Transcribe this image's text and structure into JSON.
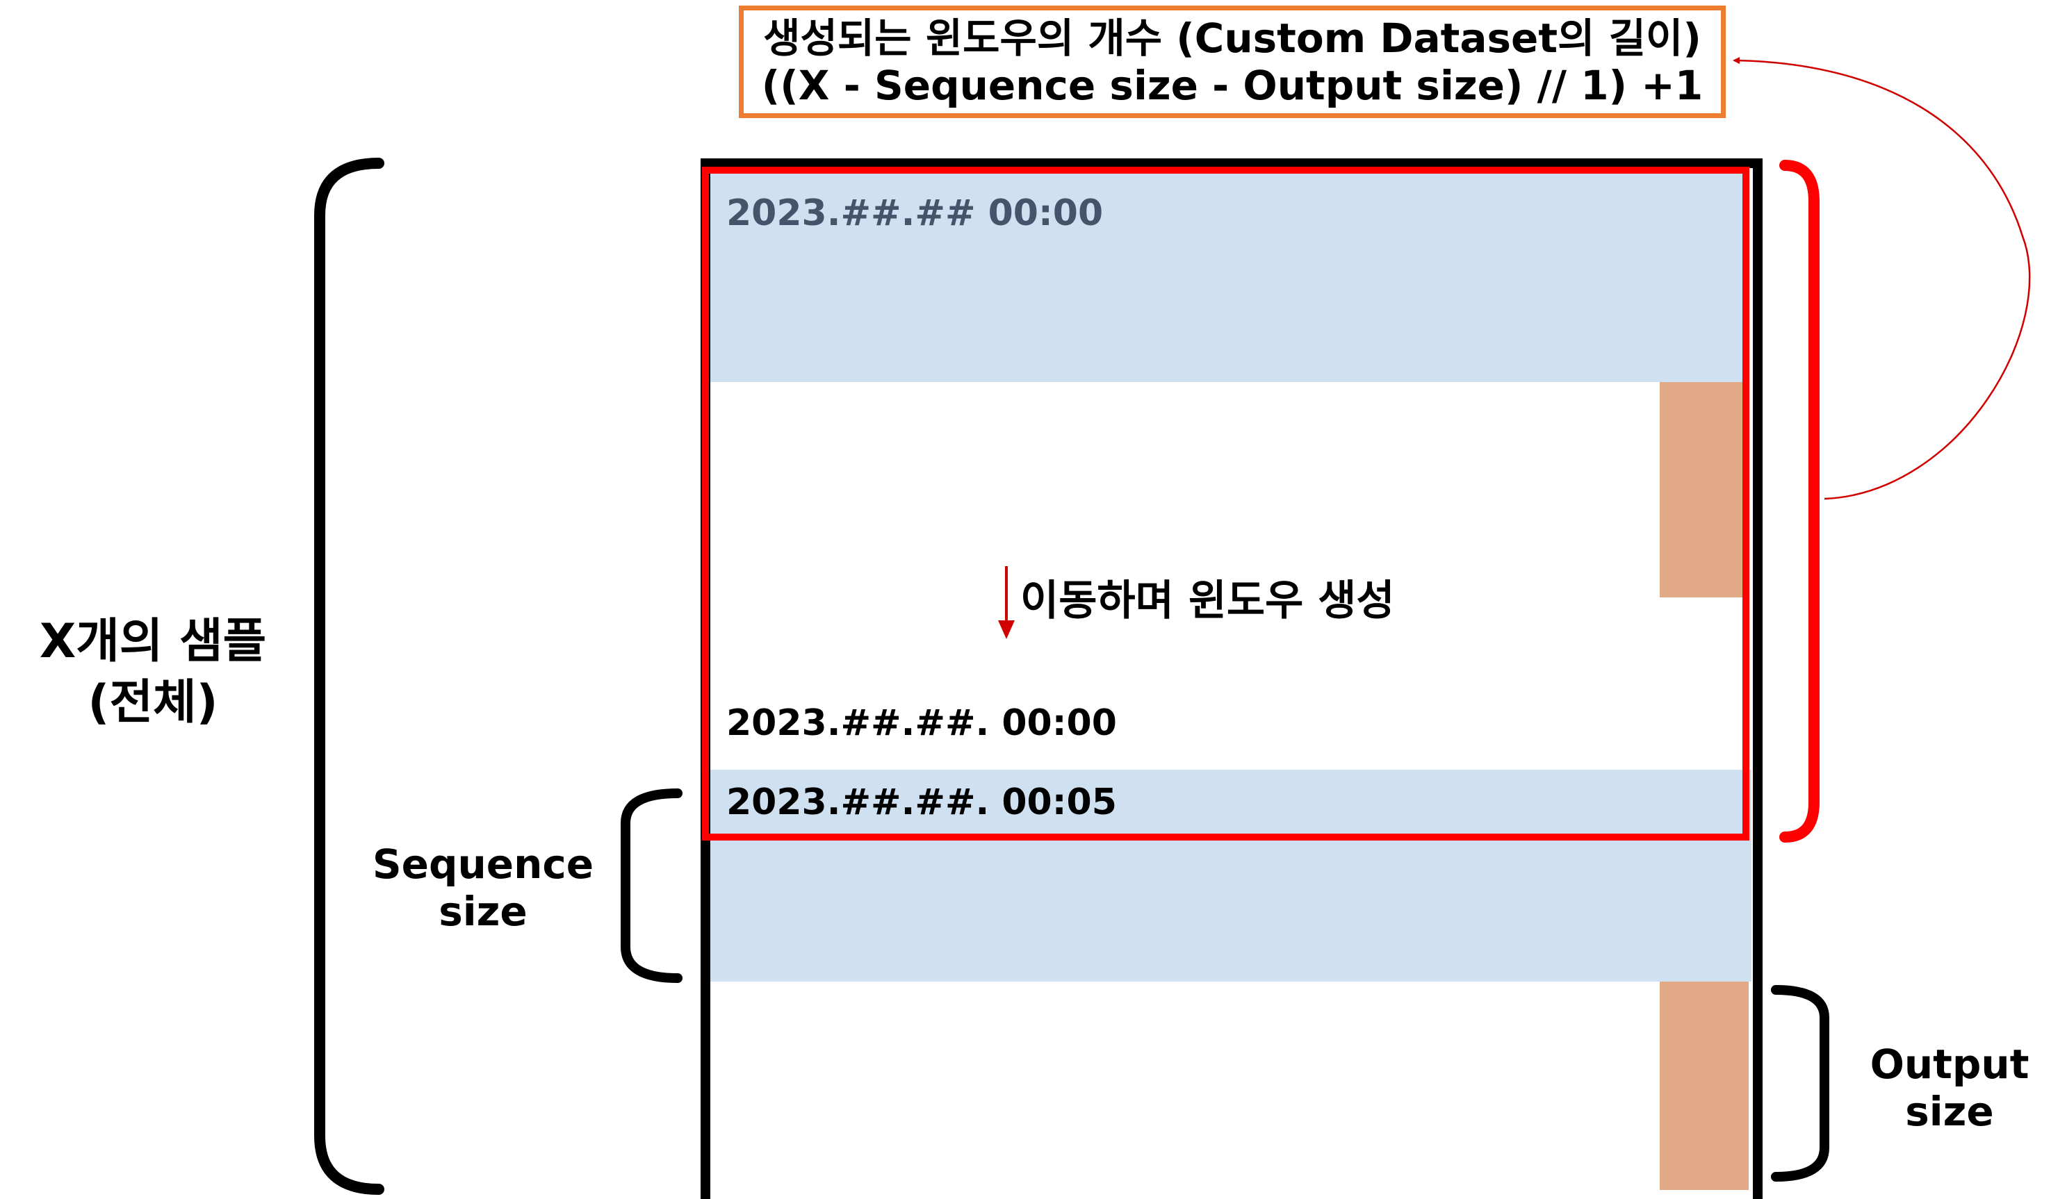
{
  "formula": {
    "line1": "생성되는 윈도우의 개수 (Custom Dataset의 길이)",
    "line2": "((X - Sequence size -  Output size) // 1) +1"
  },
  "windows": {
    "first_timestamp": "2023.##.## 00:00",
    "middle_timestamp": "2023.##.##. 00:00",
    "last_timestamp": "2023.##.##. 00:05"
  },
  "move_text": "이동하며 윈도우 생성",
  "labels": {
    "total_samples_line1": "X개의 샘플",
    "total_samples_line2": "(전체)",
    "sequence_size_line1": "Sequence",
    "sequence_size_line2": "size",
    "output_size_line1": "Output",
    "output_size_line2": "size"
  },
  "colors": {
    "sequence_fill": "#CFE0F1",
    "output_fill": "#E1A985",
    "window_outline": "#FF0000",
    "formula_border": "#ED7D31",
    "frame": "#000000"
  }
}
